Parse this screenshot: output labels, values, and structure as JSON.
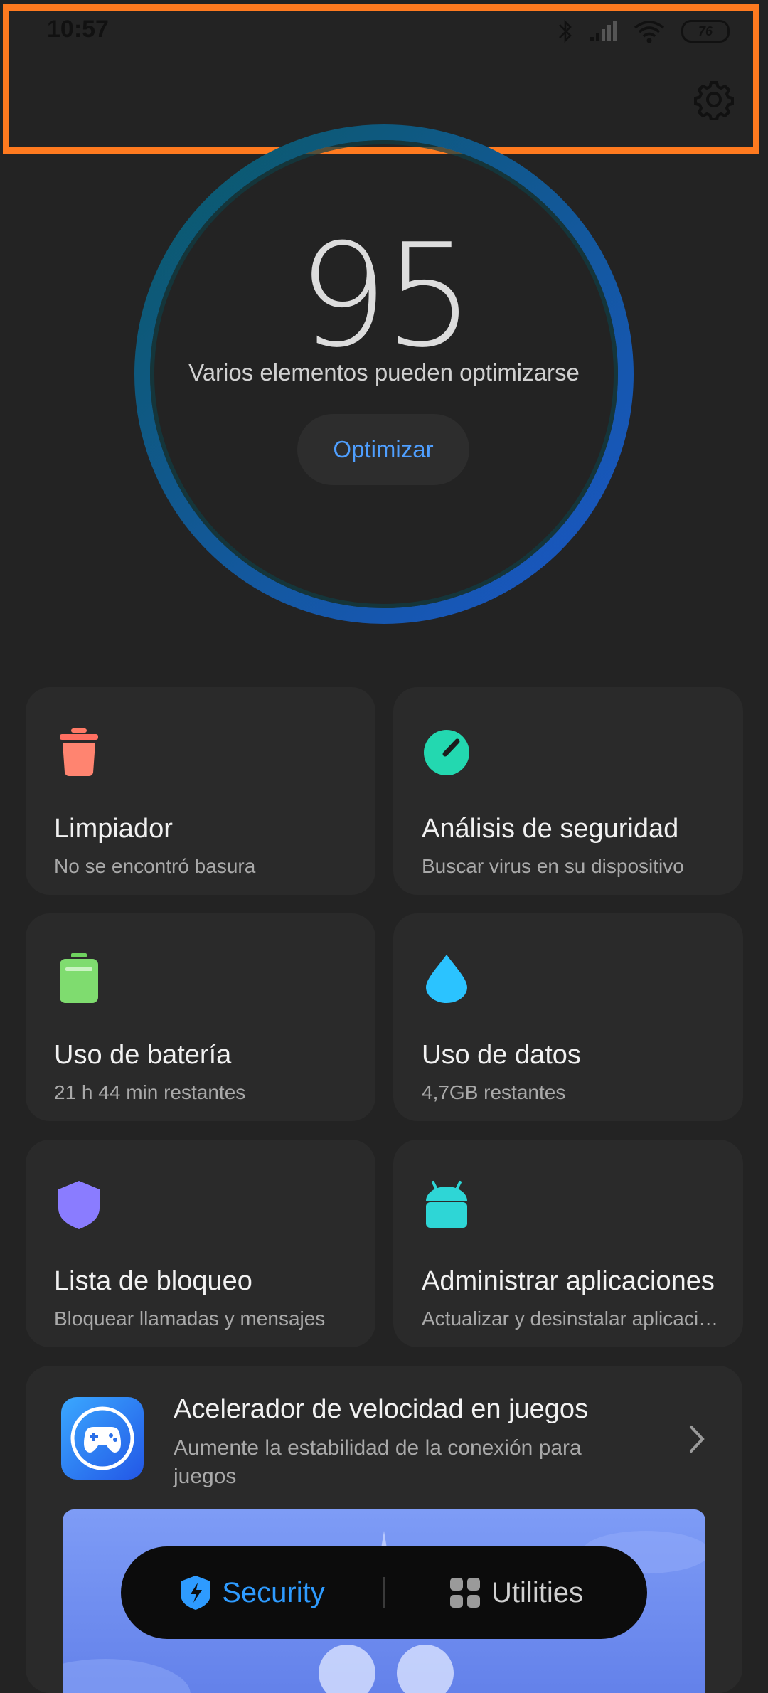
{
  "status_bar": {
    "time": "10:57",
    "battery": "76"
  },
  "score": {
    "value": "95",
    "message": "Varios elementos pueden optimizarse",
    "button_label": "Optimizar"
  },
  "cards": [
    {
      "title": "Limpiador",
      "subtitle": "No se encontró basura",
      "icon": "trash-icon",
      "color": "#ff7364"
    },
    {
      "title": "Análisis de seguridad",
      "subtitle": "Buscar virus en su dispositivo",
      "icon": "speedometer-icon",
      "color": "#23d8b0"
    },
    {
      "title": "Uso de batería",
      "subtitle": "21 h 44 min  restantes",
      "icon": "battery-icon",
      "color": "#7fdc6f"
    },
    {
      "title": "Uso de datos",
      "subtitle": "4,7GB restantes",
      "icon": "drop-icon",
      "color": "#2bc3ff"
    },
    {
      "title": "Lista de bloqueo",
      "subtitle": "Bloquear llamadas y mensajes",
      "icon": "shield-icon",
      "color": "#8a7cff"
    },
    {
      "title": "Administrar aplicaciones",
      "subtitle": "Actualizar y desinstalar aplicaciones",
      "icon": "android-icon",
      "color": "#2ed6d6"
    }
  ],
  "game_booster": {
    "title": "Acelerador de velocidad en juegos",
    "subtitle": "Aumente la estabilidad de la conexión para juegos"
  },
  "bottom_nav": {
    "security_label": "Security",
    "utilities_label": "Utilities",
    "accent_color": "#2e9bff"
  }
}
